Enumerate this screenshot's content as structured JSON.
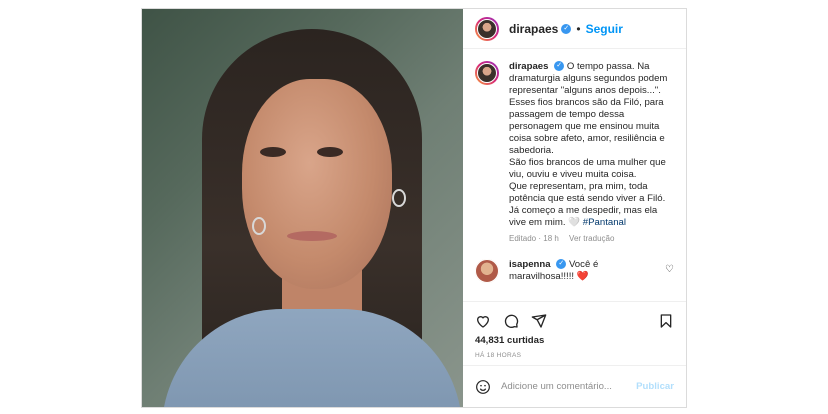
{
  "header": {
    "username": "dirapaes",
    "follow_label": "Seguir",
    "separator": "•"
  },
  "caption": {
    "username": "dirapaes",
    "lines": [
      "O tempo passa. Na dramaturgia alguns segundos podem representar \"alguns anos depois...\".",
      "Esses fios brancos são da Filó, para passagem de tempo dessa personagem que me ensinou muita coisa sobre afeto, amor, resiliência e sabedoria.",
      "São fios brancos de uma mulher que viu, ouviu e viveu muita coisa.",
      "Que representam, pra mim, toda potência que está sendo viver a Filó.",
      "Já começo a me despedir, mas ela vive em mim. 🤍"
    ],
    "hashtag": "#Pantanal",
    "edited": "Editado · 18 h",
    "translate": "Ver tradução"
  },
  "comment": {
    "username": "isapenna",
    "text": "Você é maravilhosa!!!!! ❤️"
  },
  "likes": "44,831 curtidas",
  "timestamp": "HÁ 18 HORAS",
  "add_comment": {
    "placeholder": "Adicione um comentário...",
    "publish_label": "Publicar"
  },
  "icons": {
    "like": "heart-icon",
    "comment": "comment-icon",
    "share": "share-icon",
    "save": "bookmark-icon",
    "emoji": "emoji-icon",
    "verified": "verified-icon",
    "comment_like": "heart-small-icon"
  },
  "colors": {
    "accent": "#0095f6",
    "verified": "#3897f0",
    "muted": "#8e8e8e",
    "hashtag": "#00376b",
    "publish_disabled": "#b2dffc"
  }
}
